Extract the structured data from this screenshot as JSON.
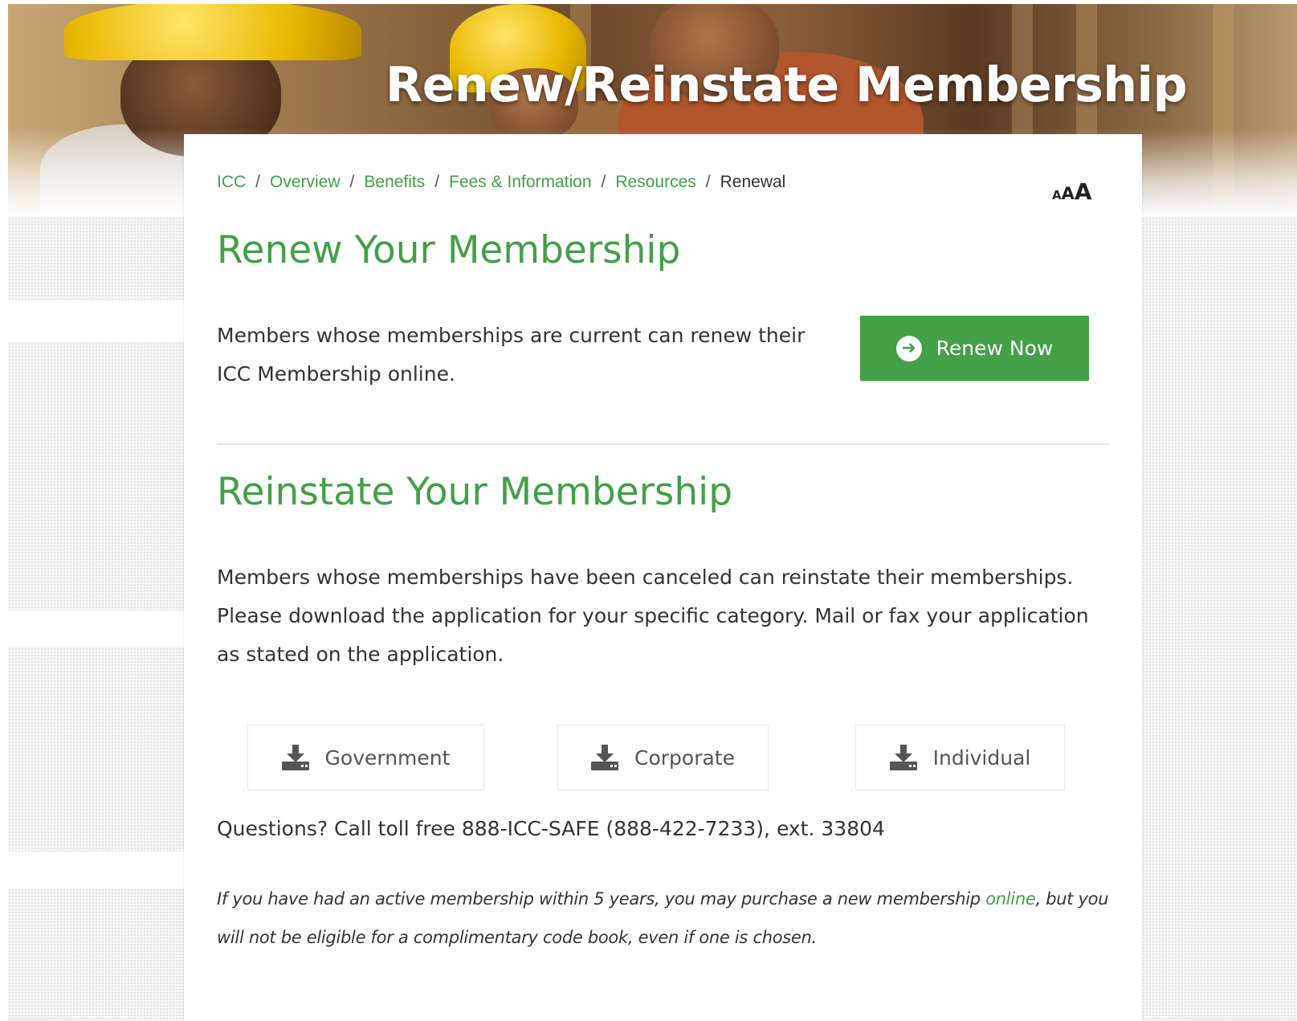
{
  "hero": {
    "title": "Renew/Reinstate Membership"
  },
  "breadcrumb": {
    "items": [
      "ICC",
      "Overview",
      "Benefits",
      "Fees & Information",
      "Resources"
    ],
    "separator": "/",
    "current": "Renewal"
  },
  "text_size": {
    "small": "A",
    "medium": "A",
    "large": "A"
  },
  "renew": {
    "heading": "Renew Your Membership",
    "body": "Members whose memberships are current can renew their ICC Membership online.",
    "button_label": "Renew Now",
    "button_icon": "arrow-circle-right-icon"
  },
  "reinstate": {
    "heading": "Reinstate Your Membership",
    "body": "Members whose memberships have been canceled can reinstate their memberships. Please download the application for your specific category. Mail or fax your application as stated on the application.",
    "downloads": [
      {
        "label": "Government",
        "icon": "download-icon"
      },
      {
        "label": "Corporate",
        "icon": "download-icon"
      },
      {
        "label": "Individual",
        "icon": "download-icon"
      }
    ]
  },
  "questions": "Questions? Call toll free 888-ICC-SAFE (888-422-7233), ext. 33804",
  "note": {
    "before_link": "If you have had an active membership within 5 years, you may purchase a new membership ",
    "link_text": "online",
    "after_link": ", but you will not be eligible for a complimentary code book, even if one is chosen."
  },
  "colors": {
    "accent": "#43a047",
    "text": "#333333"
  }
}
